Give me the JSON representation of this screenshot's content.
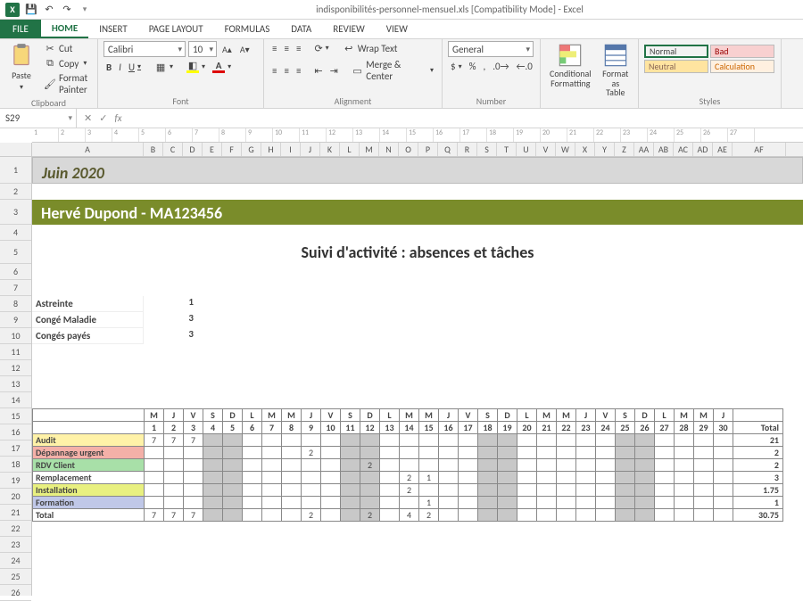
{
  "window": {
    "title": "indisponibilités-personnel-mensuel.xls  [Compatibility Mode] - Excel"
  },
  "qat": {
    "save": "save-icon",
    "undo": "undo-icon",
    "redo": "redo-icon"
  },
  "tabs": {
    "file": "FILE",
    "home": "HOME",
    "insert": "INSERT",
    "page": "PAGE LAYOUT",
    "formulas": "FORMULAS",
    "data": "DATA",
    "review": "REVIEW",
    "view": "VIEW"
  },
  "ribbon": {
    "clipboard": {
      "label": "Clipboard",
      "paste": "Paste",
      "cut": "Cut",
      "copy": "Copy",
      "fmtp": "Format Painter"
    },
    "font": {
      "label": "Font",
      "name": "Calibri",
      "size": "10",
      "bold": "B",
      "italic": "I",
      "underline": "U"
    },
    "alignment": {
      "label": "Alignment",
      "wrap": "Wrap Text",
      "merge": "Merge & Center"
    },
    "number": {
      "label": "Number",
      "format": "General"
    },
    "cond": {
      "label": "",
      "cf": "Conditional\nFormatting",
      "ft": "Format as\nTable"
    },
    "styles": {
      "label": "Styles",
      "normal": "Normal",
      "bad": "Bad",
      "neutral": "Neutral",
      "calc": "Calculation"
    }
  },
  "namebox": "S29",
  "fx": "",
  "ruler_marks": [
    "1",
    "2",
    "3",
    "4",
    "5",
    "6",
    "7",
    "8",
    "9",
    "10",
    "11",
    "12",
    "13",
    "14",
    "15",
    "16",
    "17",
    "18",
    "19",
    "20",
    "21",
    "22",
    "23",
    "24",
    "25",
    "26",
    "27"
  ],
  "cols": [
    "A",
    "B",
    "C",
    "D",
    "E",
    "F",
    "G",
    "H",
    "I",
    "J",
    "K",
    "L",
    "M",
    "N",
    "O",
    "P",
    "Q",
    "R",
    "S",
    "T",
    "U",
    "V",
    "W",
    "X",
    "Y",
    "Z",
    "AA",
    "AB",
    "AC",
    "AD",
    "AE",
    "AF"
  ],
  "rows_visible": 26,
  "sheet": {
    "month_title": "Juin 2020",
    "person_title": "Hervé Dupond -  MA123456",
    "main_title": "Suivi d'activité : absences et tâches",
    "summary": [
      {
        "label": "Astreinte",
        "value": "1"
      },
      {
        "label": "Congé Maladie",
        "value": "3"
      },
      {
        "label": "Congés payés",
        "value": "3"
      }
    ],
    "day_letters": [
      "M",
      "J",
      "V",
      "S",
      "D",
      "L",
      "M",
      "M",
      "J",
      "V",
      "S",
      "D",
      "L",
      "M",
      "M",
      "J",
      "V",
      "S",
      "D",
      "L",
      "M",
      "M",
      "J",
      "V",
      "S",
      "D",
      "L",
      "M",
      "M",
      "J"
    ],
    "day_nums": [
      "1",
      "2",
      "3",
      "4",
      "5",
      "6",
      "7",
      "8",
      "9",
      "10",
      "11",
      "12",
      "13",
      "14",
      "15",
      "16",
      "17",
      "18",
      "19",
      "20",
      "21",
      "22",
      "23",
      "24",
      "25",
      "26",
      "27",
      "28",
      "29",
      "30"
    ],
    "weekend_idx": [
      3,
      4,
      10,
      11,
      17,
      18,
      24,
      25
    ],
    "total_hdr": "Total",
    "categories": [
      {
        "name": "Audit",
        "cls": "cat-audit",
        "vals": {
          "0": "7",
          "1": "7",
          "2": "7"
        },
        "total": "21"
      },
      {
        "name": "Dépannage urgent",
        "cls": "cat-dep",
        "vals": {
          "8": "2"
        },
        "total": "2"
      },
      {
        "name": "RDV Client",
        "cls": "cat-rdv",
        "vals": {
          "11": "2"
        },
        "total": "2"
      },
      {
        "name": "Remplacement",
        "cls": "cat-remp",
        "vals": {
          "13": "2",
          "14": "1"
        },
        "total": "3"
      },
      {
        "name": "Installation",
        "cls": "cat-inst",
        "vals": {
          "13": "2"
        },
        "total": "1.75"
      },
      {
        "name": "Formation",
        "cls": "cat-form",
        "vals": {
          "14": "1"
        },
        "total": "1"
      }
    ],
    "total_row": {
      "label": "Total",
      "vals": {
        "0": "7",
        "1": "7",
        "2": "7",
        "8": "2",
        "11": "2",
        "13": "4",
        "14": "2"
      },
      "total": "30.75"
    }
  }
}
